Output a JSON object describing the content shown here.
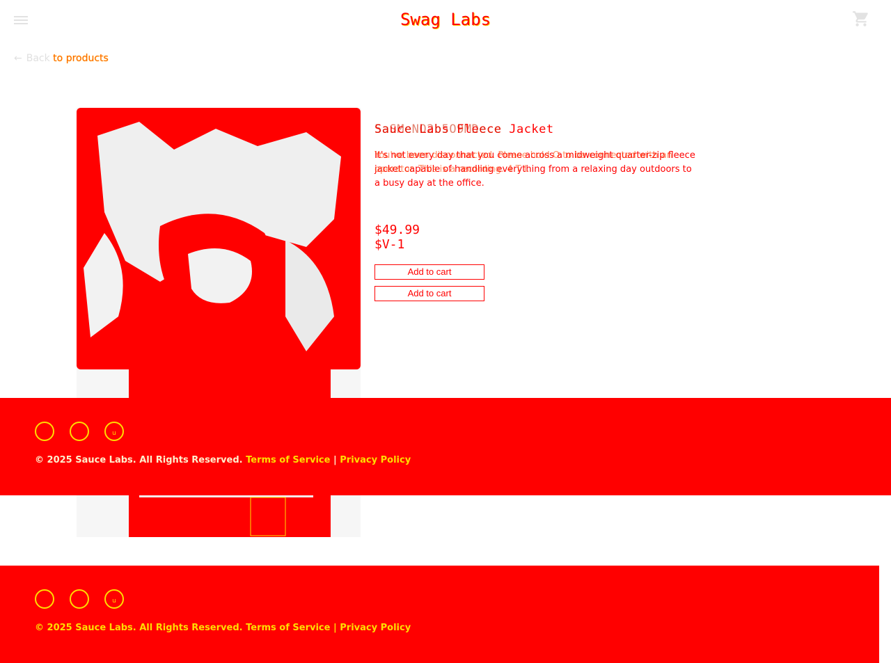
{
  "header": {
    "title": "Swag Labs",
    "menu_icon": "hamburger-menu-icon",
    "cart_icon": "shopping-cart-icon"
  },
  "navigation": {
    "back_arrow": "←",
    "back_word": "Back",
    "back_rest": " to products"
  },
  "product": {
    "name": "Sauce Labs Fleece Jacket",
    "name_overlay": "5aSMeNO2b5O9MDece",
    "description": "It's not every day that you come across a midweight quarter-zip fleece jacket capable of handling everything from a relaxing day outdoors to a busy day at the office.",
    "description_overlay": "You've been disconnected. Please hold O to be connected with an operator. This is a recording. 4 T I.",
    "price": "$49.99",
    "price_alt": "$V-1",
    "add_to_cart_label": "Add to cart",
    "add_to_cart_label_2": "Add to cart"
  },
  "footer": {
    "social": [
      {
        "name": "twitter-icon",
        "glyph": ""
      },
      {
        "name": "facebook-icon",
        "glyph": ""
      },
      {
        "name": "linkedin-icon",
        "glyph": "u"
      }
    ],
    "copyright": "© 2025 Sauce Labs. All Rights Reserved.",
    "terms": "Terms of Service",
    "separator": "|",
    "privacy": "Privacy Policy"
  },
  "colors": {
    "accent": "#ff0000",
    "highlight": "#ffdd00",
    "background": "#ffffff",
    "image_light": "#eeeeee"
  }
}
